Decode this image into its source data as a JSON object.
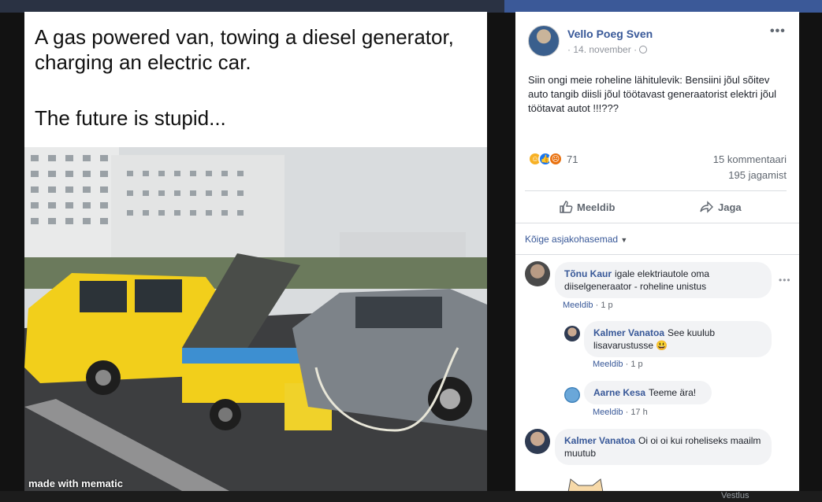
{
  "photo": {
    "caption_line1": "A gas powered van, towing a diesel generator, charging an electric car.",
    "caption_line2": "The future is stupid...",
    "watermark": "made with mematic"
  },
  "post": {
    "author": "Vello Poeg Sven",
    "date": "14. november",
    "more": "•••",
    "text": "Siin ongi meie roheline lähitulevik: Bensiini jõul sõitev auto tangib diisli jõul töötavast generaatorist elektri jõul töötavat autot !!!???",
    "reaction_count": "71",
    "comments_count": "15 kommentaari",
    "shares_count": "195 jagamist",
    "like_label": "Meeldib",
    "share_label": "Jaga",
    "sort_label": "Kõige asjakohasemad"
  },
  "comments": [
    {
      "name": "Tõnu Kaur",
      "text": "igale elektriautole oma diiselgeneraator - roheline unistus",
      "like": "Meeldib",
      "time": "1 p"
    },
    {
      "name": "Kalmer Vanatoa",
      "text": "See kuulub lisavarustusse 😃",
      "like": "Meeldib",
      "time": "1 p"
    },
    {
      "name": "Aarne Kesa",
      "text": "Teeme ära!",
      "like": "Meeldib",
      "time": "17 h"
    },
    {
      "name": "Kalmer Vanatoa",
      "text": "Oi oi oi kui roheliseks maailm muutub",
      "like": "",
      "time": ""
    }
  ],
  "footer": {
    "chat_label": "Vestlus"
  },
  "colors": {
    "link_blue": "#385898",
    "facebook_blue": "#3b5998",
    "van_yellow": "#f2cf1b"
  }
}
